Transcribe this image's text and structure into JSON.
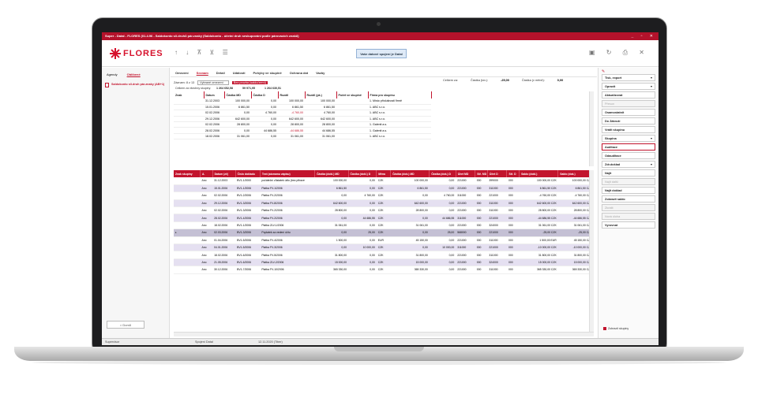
{
  "window": {
    "title": "Super - Datal - FLORES (01.4.96 - Saldokonto s/i.druhů pár.znaky (Saldokonto - účetní druh seskupování podle párovacích znaků)",
    "buttons": "_ ▫ ✕"
  },
  "header": {
    "logo": "FLORES",
    "toolbar_icons": "↑ ↓ ⊼ ⊻ ☰",
    "connect_label": "Vaše datové spojení je Datal",
    "right_icons": "▣ ↻ ⎙ ✕"
  },
  "sidebar": {
    "tabs": [
      "Agendy",
      "Oblíbené"
    ],
    "items": [
      {
        "label": "Saldokonto s/i.druh pár.znaky (AB+1)"
      }
    ],
    "home_label": "Domů"
  },
  "main": {
    "tabs": [
      "Omezení",
      "Seznam",
      "Detail",
      "Události",
      "Pohyby ve skupině",
      "Ochrana dat",
      "Vazby"
    ],
    "active_tab": "Seznam",
    "filter": {
      "label": "Záznam: 8 z 13",
      "select": "Vybrané omezení",
      "tag": "Bez prozba (saldo/zemí)"
    },
    "celkem_label": "Celkem za všechny skupiny:",
    "celkem_values": [
      "1 264 652,58",
      "59 971,95",
      "1 264 630,51"
    ],
    "summary": {
      "celkem_za": "Celkem za:",
      "castka_label": "Částka (tzv.):",
      "castka_value": "-25,00",
      "castka_mena_label": "Částka (v měně):",
      "castka_mena_value": "0,00"
    },
    "upper_columns": [
      "Znak",
      "Datum",
      "Částka MD",
      "Částka D",
      "Rozdíl",
      "Rozdíl (pk.)",
      "Počet ve skupině",
      "Firma pro skupinu"
    ],
    "upper_rows": [
      [
        "",
        "31.12.2003",
        "100 000,00",
        "0,00",
        "100 000,00",
        "100 000,00",
        "",
        "1. Místo příslušnosti firmě"
      ],
      [
        "",
        "15.01.2006",
        "6 861,50",
        "0,00",
        "6 861,50",
        "6 861,50",
        "",
        "1. ABC s.r.o."
      ],
      [
        "",
        "02.02.2006",
        "0,00",
        "4 760,00",
        "-4 760,00",
        "4 760,00",
        "",
        "1. ABC s.r.o."
      ],
      [
        "",
        "29.12.2006",
        "642 600,00",
        "0,00",
        "642 600,00",
        "642 600,00",
        "",
        "1. ABC s.r.o."
      ],
      [
        "",
        "02.02.2006",
        "28 800,00",
        "0,00",
        "28 800,00",
        "28 800,00",
        "",
        "1. Galenit a.s."
      ],
      [
        "",
        "28.02.2006",
        "0,00",
        "44 686,55",
        "-44 686,55",
        "44 686,55",
        "",
        "1. Galenit a.s."
      ],
      [
        "",
        "18.02.2006",
        "31 061,00",
        "0,00",
        "31 061,00",
        "31 061,00",
        "",
        "1. ABC s.r.o."
      ]
    ],
    "lower_columns": [
      "Znak skupiny",
      "A.",
      "Datum (zč)",
      "Číslo dokladu",
      "Text (záznamu zápisu)",
      "Částka (dokl.) MD",
      "Částka (dokl.) D",
      "Měna",
      "Částka (dok.) MD",
      "Částka (dok.) D",
      "Účet MD",
      "Stř. MD",
      "Účet D",
      "Stř. D",
      "Saldo (dokl.)",
      "Saldo (dok.)"
    ],
    "lower_rows": [
      {
        "style": "",
        "cells": [
          "",
          "Ano",
          "31.12.2003",
          "BV1-1/2000",
          "počáteční zůstatek účtu (bez přiraze",
          "100 000,00",
          "0,00",
          "CZK",
          "100 000,00",
          "0,00",
          "221000",
          "000",
          "399000",
          "000",
          "100 000,00 CZK",
          "100 000,00 CZK"
        ]
      },
      {
        "style": "alt",
        "cells": [
          "",
          "Ano",
          "15.01.2006",
          "BV1-1/2006",
          "Platba FV-1/2006",
          "6 861,50",
          "0,00",
          "CZK",
          "6 861,50",
          "0,00",
          "221000",
          "000",
          "311000",
          "000",
          "6 861,50 CZK",
          "6 861,50 CZK"
        ]
      },
      {
        "style": "",
        "cells": [
          "",
          "Ano",
          "02.02.2006",
          "BV1-2/2006",
          "Platba FV-2/2006",
          "0,00",
          "4 760,00",
          "CZK",
          "0,00",
          "4 760,00",
          "311000",
          "000",
          "221000",
          "000",
          "-4 760,00 CZK",
          "-4 760,00 CZK"
        ]
      },
      {
        "style": "alt",
        "cells": [
          "",
          "Ano",
          "29.12.2006",
          "BV1-3/2006",
          "Platba FV-8/2006",
          "642 600,00",
          "0,00",
          "CZK",
          "642 600,00",
          "0,00",
          "221000",
          "000",
          "311000",
          "000",
          "642 600,00 CZK",
          "642 600,00 CZK"
        ]
      },
      {
        "style": "",
        "cells": [
          "",
          "Ano",
          "02.02.2006",
          "BV1-3/2006",
          "Platba FV-2/2006",
          "28 800,00",
          "0,00",
          "CZK",
          "28 800,00",
          "0,00",
          "221000",
          "000",
          "311000",
          "000",
          "28 800,00 CZK",
          "28 800,00 CZK"
        ]
      },
      {
        "style": "alt",
        "cells": [
          "",
          "Ano",
          "28.02.2006",
          "BV1-4/2006",
          "Platba FV-2/2006",
          "0,00",
          "44 686,55",
          "CZK",
          "0,00",
          "44 686,55",
          "311000",
          "000",
          "221000",
          "000",
          "-44 686,55 CZK",
          "-44 686,55 CZK"
        ]
      },
      {
        "style": "",
        "cells": [
          "",
          "Ano",
          "18.02.2006",
          "BV1-1/2006",
          "Platba ZLV-1/2006",
          "31 061,00",
          "0,00",
          "CZK",
          "31 061,00",
          "0,00",
          "221000",
          "000",
          "324000",
          "000",
          "31 061,00 CZK",
          "31 061,00 CZK"
        ]
      },
      {
        "style": "sel",
        "cells": [
          "▸",
          "Ano",
          "02.03.2006",
          "BV1-3/2006",
          "Poplatek za vedení účtu",
          "0,00",
          "25,00",
          "CZK",
          "0,00",
          "25,00",
          "568000",
          "000",
          "221000",
          "000",
          "-25,00 CZK",
          "-25,00 CZK"
        ]
      },
      {
        "style": "",
        "cells": [
          "",
          "Ano",
          "01.04.2006",
          "BV1-5/2006",
          "Platba FV-4/2006",
          "1 500,00",
          "0,00",
          "EUR",
          "45 150,00",
          "0,00",
          "221000",
          "000",
          "311000",
          "000",
          "1 500,00 EUR",
          "45 150,00 CZK"
        ]
      },
      {
        "style": "alt",
        "cells": [
          "",
          "Ano",
          "04.01.2006",
          "BV1-5/2006",
          "Platba FV-3/2006",
          "0,00",
          "10 000,00",
          "CZK",
          "0,00",
          "10 000,00",
          "311000",
          "000",
          "221000",
          "000",
          "-10 000,00 CZK",
          "-10 000,00 CZK"
        ]
      },
      {
        "style": "",
        "cells": [
          "",
          "Ano",
          "18.02.2006",
          "BV1-6/2006",
          "Platba FV-5/2006",
          "31 800,00",
          "0,00",
          "CZK",
          "31 800,00",
          "0,00",
          "221000",
          "000",
          "311000",
          "000",
          "31 800,00 CZK",
          "31 800,00 CZK"
        ]
      },
      {
        "style": "alt",
        "cells": [
          "",
          "Ano",
          "21.05.2006",
          "BV1-6/2006",
          "Platba ZLV-2/2006",
          "15 000,00",
          "0,00",
          "CZK",
          "15 000,00",
          "0,00",
          "221000",
          "000",
          "324000",
          "000",
          "15 000,00 CZK",
          "15 000,00 CZK"
        ]
      },
      {
        "style": "",
        "cells": [
          "",
          "Ano",
          "30.12.2006",
          "BV1-7/2006",
          "Platba FV-10/2006",
          "365 330,00",
          "0,00",
          "CZK",
          "365 330,00",
          "0,00",
          "221000",
          "000",
          "311000",
          "000",
          "365 330,00 CZK",
          "365 330,00 CZK"
        ]
      }
    ]
  },
  "rpanel": {
    "buttons": [
      {
        "label": "Tisk, export",
        "caret": "▾",
        "state": ""
      },
      {
        "label": "Opravit",
        "caret": "▾",
        "state": ""
      },
      {
        "label": "Aktualizovat",
        "caret": "",
        "state": ""
      },
      {
        "label": "Přesun",
        "caret": "",
        "state": "disabled"
      },
      {
        "label": "Osamostatnit",
        "caret": "",
        "state": ""
      },
      {
        "label": "Do Zákroží",
        "caret": "",
        "state": ""
      },
      {
        "label": "Vrátit skupinu",
        "caret": "",
        "state": ""
      },
      {
        "label": "Skupina",
        "caret": "▾",
        "state": ""
      },
      {
        "label": "Auditace",
        "caret": "",
        "state": "active"
      },
      {
        "label": "Odauditace",
        "caret": "",
        "state": ""
      },
      {
        "label": "Zdr.doklad",
        "caret": "▾",
        "state": ""
      }
    ],
    "plain": [
      "Najít",
      "Najít další",
      "Najít doklad",
      "Zobrazit saldo",
      "Zkrátit",
      "Nová úloha",
      "Vyrovnat"
    ],
    "check_label": "Zobrazit skupiny"
  },
  "statusbar": {
    "user": "Supervisor",
    "conn": "Spojení Datal",
    "date": "12.11.2020 (Tiber)"
  }
}
